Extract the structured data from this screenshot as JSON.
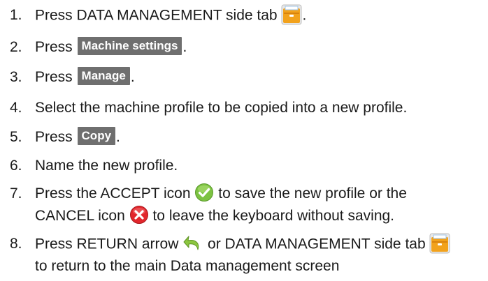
{
  "steps": [
    {
      "number": "1.",
      "parts": {
        "a": "Press DATA MANAGEMENT side tab",
        "b": "."
      },
      "icons": [
        "data-management-tab-icon"
      ]
    },
    {
      "number": "2.",
      "parts": {
        "a": "Press",
        "button": "Machine settings",
        "b": "."
      }
    },
    {
      "number": "3.",
      "parts": {
        "a": "Press",
        "button": "Manage",
        "b": "."
      }
    },
    {
      "number": "4.",
      "parts": {
        "a": "Select the machine profile to be copied into a new profile."
      }
    },
    {
      "number": "5.",
      "parts": {
        "a": "Press",
        "button": "Copy",
        "b": "."
      }
    },
    {
      "number": "6.",
      "parts": {
        "a": "Name the new profile."
      }
    },
    {
      "number": "7.",
      "parts": {
        "a": "Press the ACCEPT icon",
        "b": "to save the new profile or the",
        "c": "CANCEL icon",
        "d": "to leave the keyboard without saving."
      },
      "icons": [
        "accept-check-icon",
        "cancel-x-icon"
      ]
    },
    {
      "number": "8.",
      "parts": {
        "a": "Press RETURN arrow",
        "b": "or DATA MANAGEMENT side tab",
        "c": "to return to the main Data management screen"
      },
      "icons": [
        "return-arrow-icon",
        "data-management-tab-icon"
      ]
    }
  ],
  "colors": {
    "text": "#1a1a1a",
    "button_chip": "#6f6f6f",
    "tab_icon": "#f2a21c",
    "accept": "#7cc242",
    "cancel": "#e2262c",
    "return_arrow": "#8cc63f"
  }
}
